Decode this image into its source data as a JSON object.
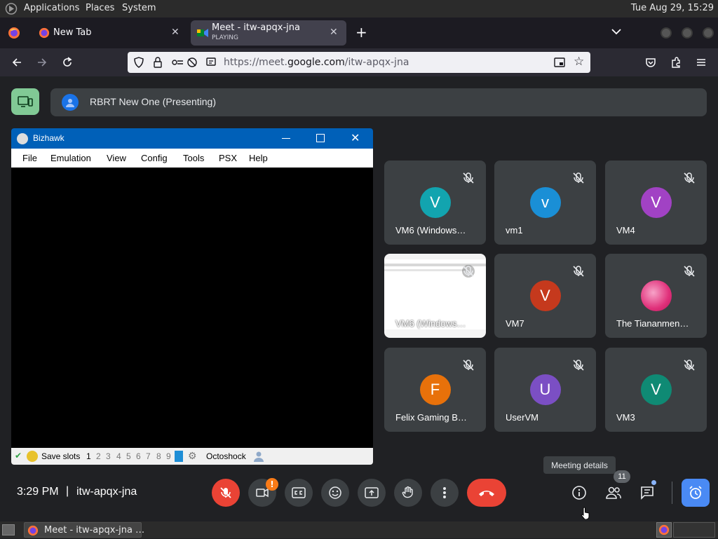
{
  "panel": {
    "menus": [
      "Applications",
      "Places",
      "System"
    ],
    "clock": "Tue Aug 29, 15:29"
  },
  "browser": {
    "tabs": [
      {
        "title": "New Tab",
        "subtitle": ""
      },
      {
        "title": "Meet - itw-apqx-jna",
        "subtitle": "PLAYING"
      }
    ],
    "url_prefix": "https://meet.",
    "url_domain": "google.com",
    "url_path": "/itw-apqx-jna"
  },
  "meet": {
    "presenter_label": "RBRT New One (Presenting)",
    "time": "3:29 PM",
    "separator": "|",
    "meeting_code": "itw-apqx-jna",
    "tooltip": "Meeting details",
    "people_count": "11",
    "participants": [
      {
        "name": "VM6 (Windows…",
        "initial": "V",
        "color": "#12a4af"
      },
      {
        "name": "vm1",
        "initial": "v",
        "color": "#1a8fd6"
      },
      {
        "name": "VM4",
        "initial": "V",
        "color": "#a142c4"
      },
      {
        "name": "VM6 (Windows…",
        "initial": "",
        "color": "#ffffff"
      },
      {
        "name": "VM7",
        "initial": "V",
        "color": "#c5391d"
      },
      {
        "name": "The Tiananmen…",
        "initial": "",
        "color": "#e05a9a"
      },
      {
        "name": "Felix Gaming B…",
        "initial": "F",
        "color": "#e8710a"
      },
      {
        "name": "UserVM",
        "initial": "U",
        "color": "#7b4fc4"
      },
      {
        "name": "VM3",
        "initial": "V",
        "color": "#0f8a74"
      }
    ]
  },
  "bizhawk": {
    "title": "Bizhawk",
    "menu": [
      "File",
      "Emulation",
      "View",
      "Config",
      "Tools",
      "PSX",
      "Help"
    ],
    "save_slots_label": "Save slots",
    "slots": [
      "1",
      "2",
      "3",
      "4",
      "5",
      "6",
      "7",
      "8",
      "9"
    ],
    "core": "Octoshock"
  },
  "taskbar": {
    "window_label": "Meet - itw-apqx-jna …"
  },
  "colors": {
    "meet_bg": "#202124",
    "tile_bg": "#3c4043",
    "end_call": "#ea4335",
    "accent_blue": "#8ab4f8",
    "bizhawk_title": "#0060b8"
  }
}
